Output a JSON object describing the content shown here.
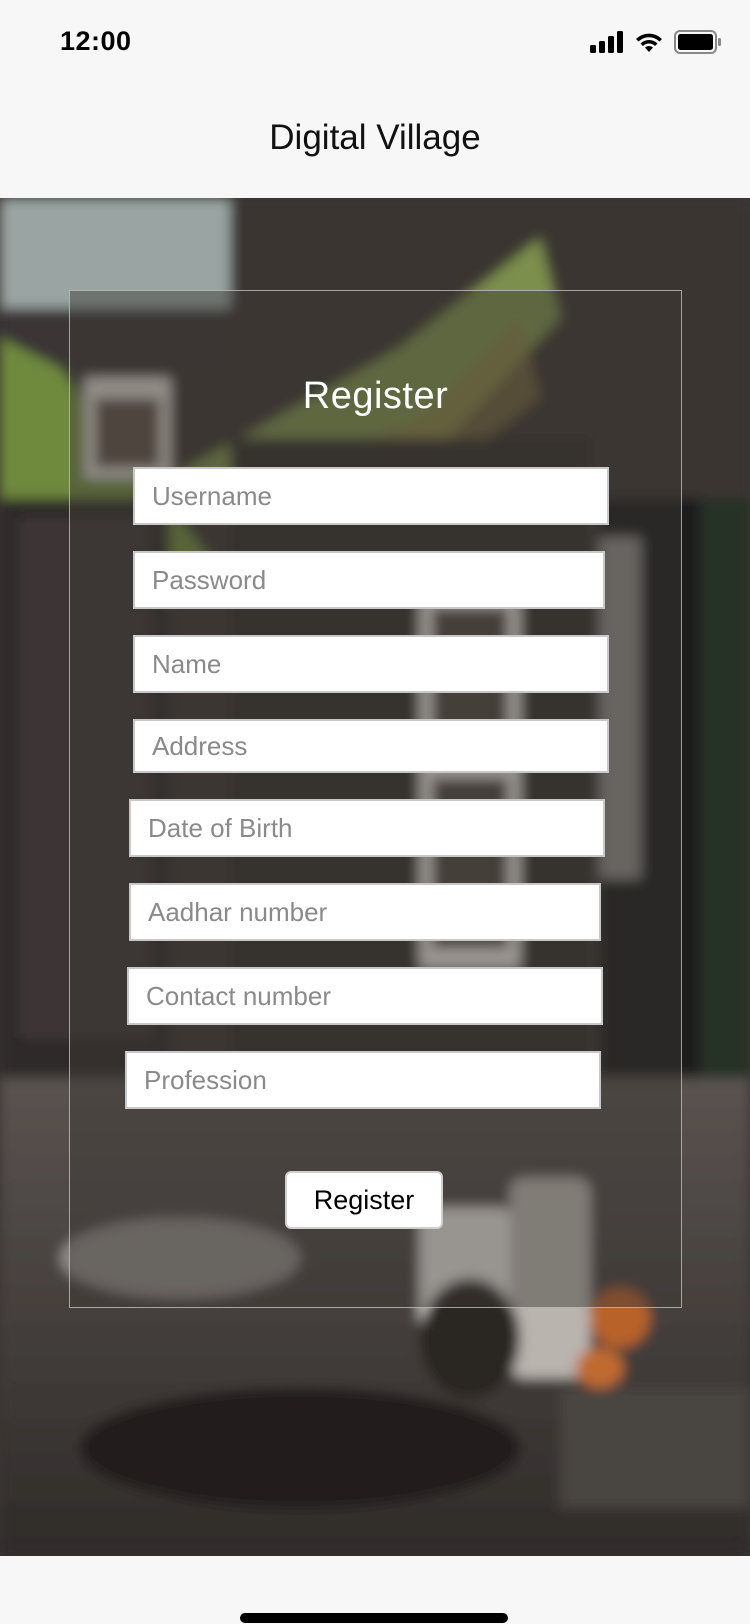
{
  "status_bar": {
    "time": "12:00",
    "icons": [
      "cellular-signal-icon",
      "wifi-icon",
      "battery-icon"
    ]
  },
  "header": {
    "title": "Digital Village"
  },
  "form": {
    "title": "Register",
    "fields": [
      {
        "placeholder": "Username",
        "value": ""
      },
      {
        "placeholder": "Password",
        "value": ""
      },
      {
        "placeholder": "Name",
        "value": ""
      },
      {
        "placeholder": "Address",
        "value": ""
      },
      {
        "placeholder": "Date of Birth",
        "value": ""
      },
      {
        "placeholder": "Aadhar number",
        "value": ""
      },
      {
        "placeholder": "Contact number",
        "value": ""
      },
      {
        "placeholder": "Profession",
        "value": ""
      }
    ],
    "submit_label": "Register"
  },
  "colors": {
    "background": "#f7f7f7",
    "panel_overlay": "#3c3734",
    "panel_title": "#ffffff",
    "field_bg": "#ffffff",
    "placeholder": "#8a8a8a"
  }
}
